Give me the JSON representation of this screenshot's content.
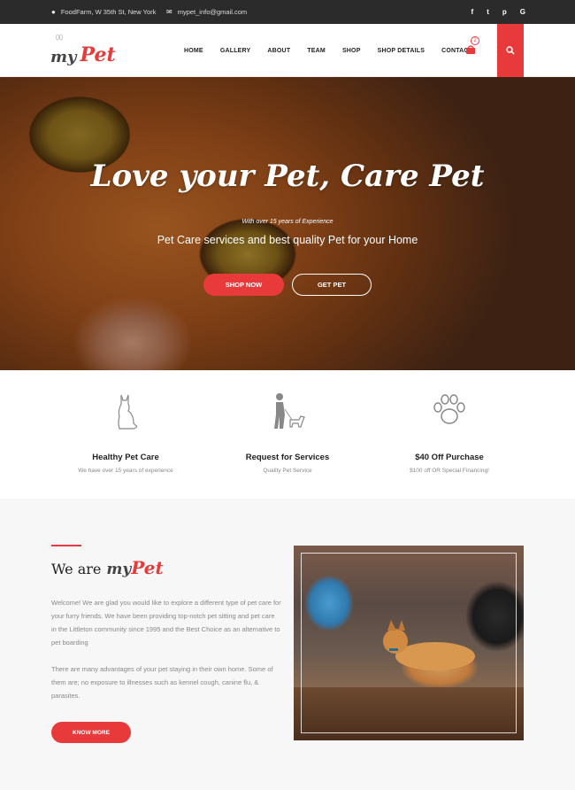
{
  "topbar": {
    "address": "FoodFarm, W 35th St, New York",
    "email": "mypet_info@gmail.com",
    "social": [
      "f",
      "t",
      "p",
      "G"
    ]
  },
  "header": {
    "logo_my": "my",
    "logo_pet": "Pet",
    "nav": [
      "HOME",
      "GALLERY",
      "ABOUT",
      "TEAM",
      "SHOP",
      "SHOP DETAILS",
      "CONTACT"
    ],
    "cart_count": "2"
  },
  "hero": {
    "title": "Love your Pet, Care Pet",
    "subtitle": "With over 15 years of Experience",
    "description": "Pet Care services and best quality Pet for your Home",
    "shop_now": "SHOP NOW",
    "get_pet": "GET PET"
  },
  "features": [
    {
      "title": "Healthy Pet Care",
      "subtitle": "We have over 15 years of experience"
    },
    {
      "title": "Request for Services",
      "subtitle": "Quality Pet Service"
    },
    {
      "title": "$40 Off Purchase",
      "subtitle": "$100 off OR Special Financing!"
    }
  ],
  "about": {
    "we_are": "We are",
    "my": "my",
    "pet": "Pet",
    "paragraph1": "Welcome! We are glad you would like to explore a different type of pet care for your furry friends. We have been providing top-notch pet sitting and pet care in the Littleton community since 1995 and the Best Choice as an alternative to pet boarding",
    "paragraph2": "There are many advantages of your pet staying in their own home. Some of them are; no exposure to illnesses such as kennel cough, canine flu, & parasites.",
    "button": "KNOW MORE"
  },
  "colors": {
    "accent": "#e83a3a",
    "topbar": "#2b2b2b"
  }
}
